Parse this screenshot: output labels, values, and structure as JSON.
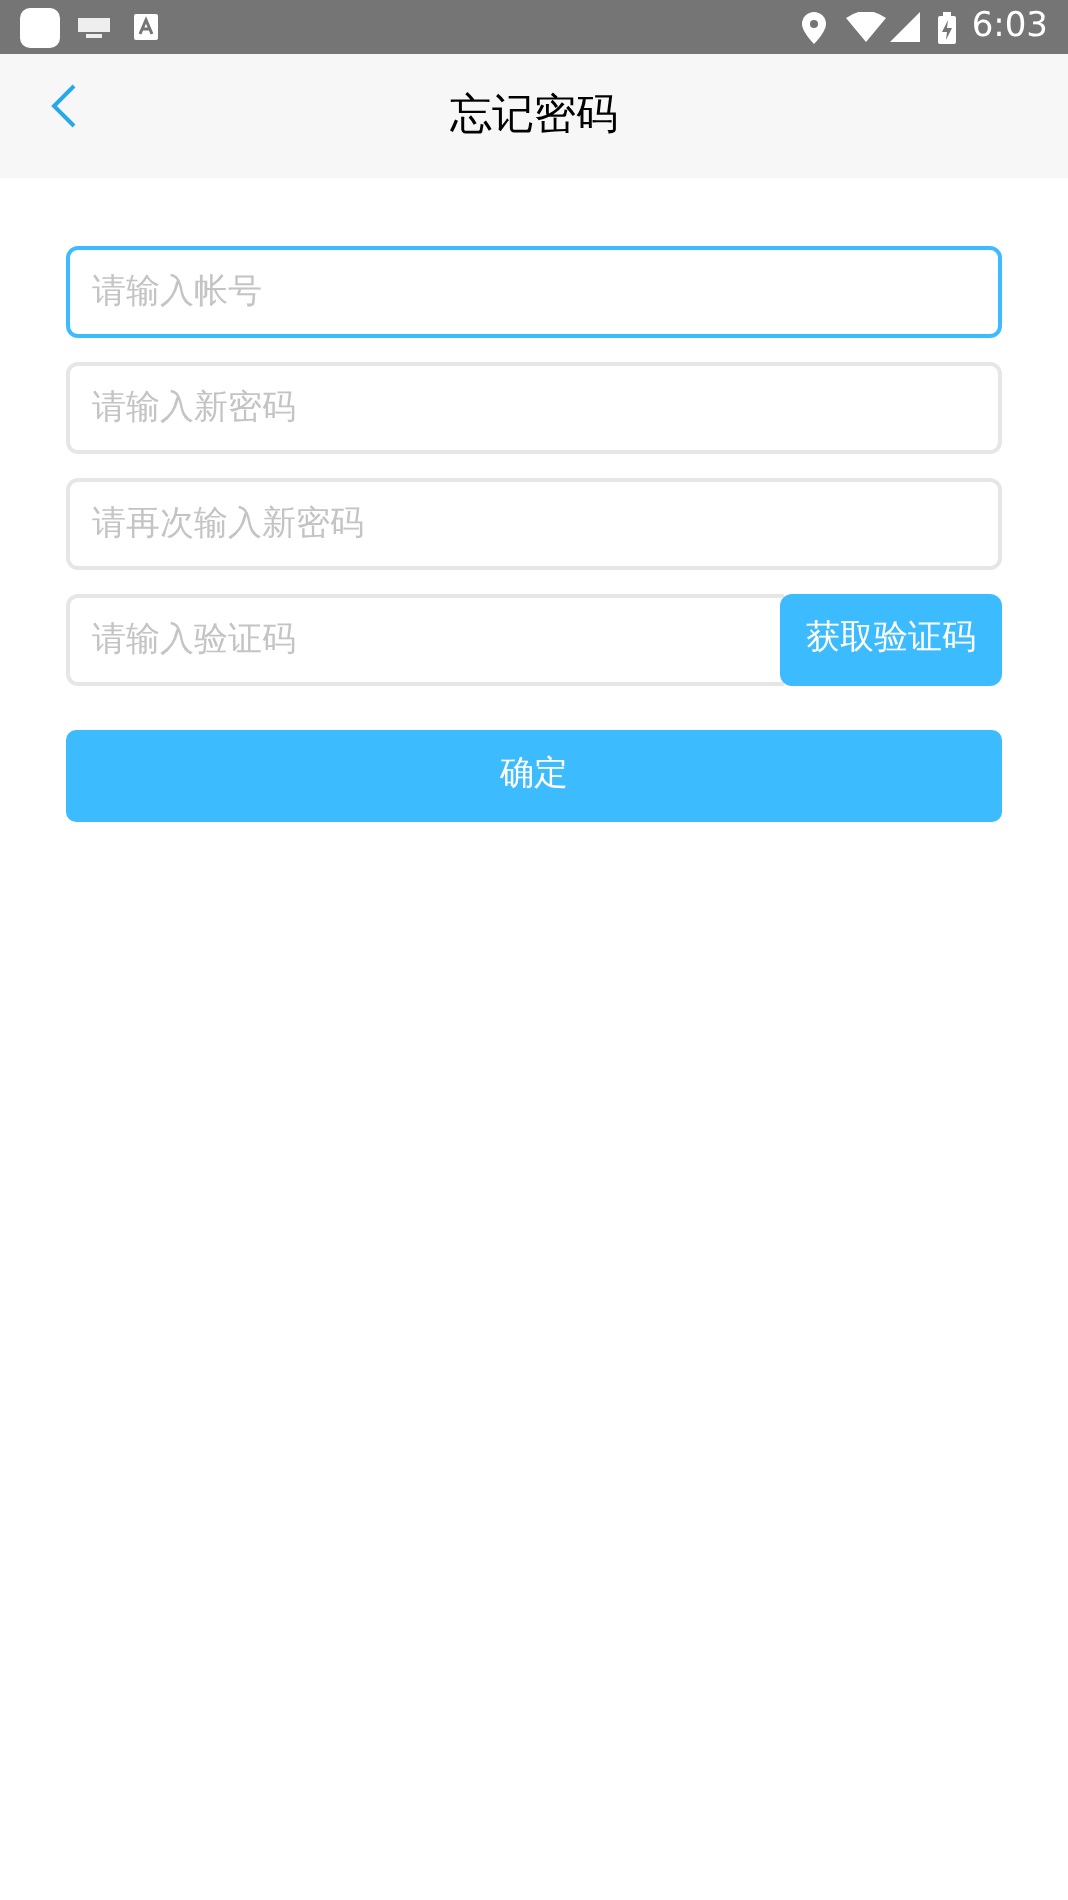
{
  "status_bar": {
    "time": "6:03"
  },
  "header": {
    "title": "忘记密码"
  },
  "fields": [
    {
      "kind": "text",
      "placeholder": "请输入帐号",
      "focused": true
    },
    {
      "kind": "text",
      "placeholder": "请输入新密码",
      "focused": false
    },
    {
      "kind": "text",
      "placeholder": "请再次输入新密码",
      "focused": false
    },
    {
      "kind": "code",
      "placeholder": "请输入验证码",
      "focused": false,
      "button": "获取验证码"
    }
  ],
  "submit_button": "确定"
}
